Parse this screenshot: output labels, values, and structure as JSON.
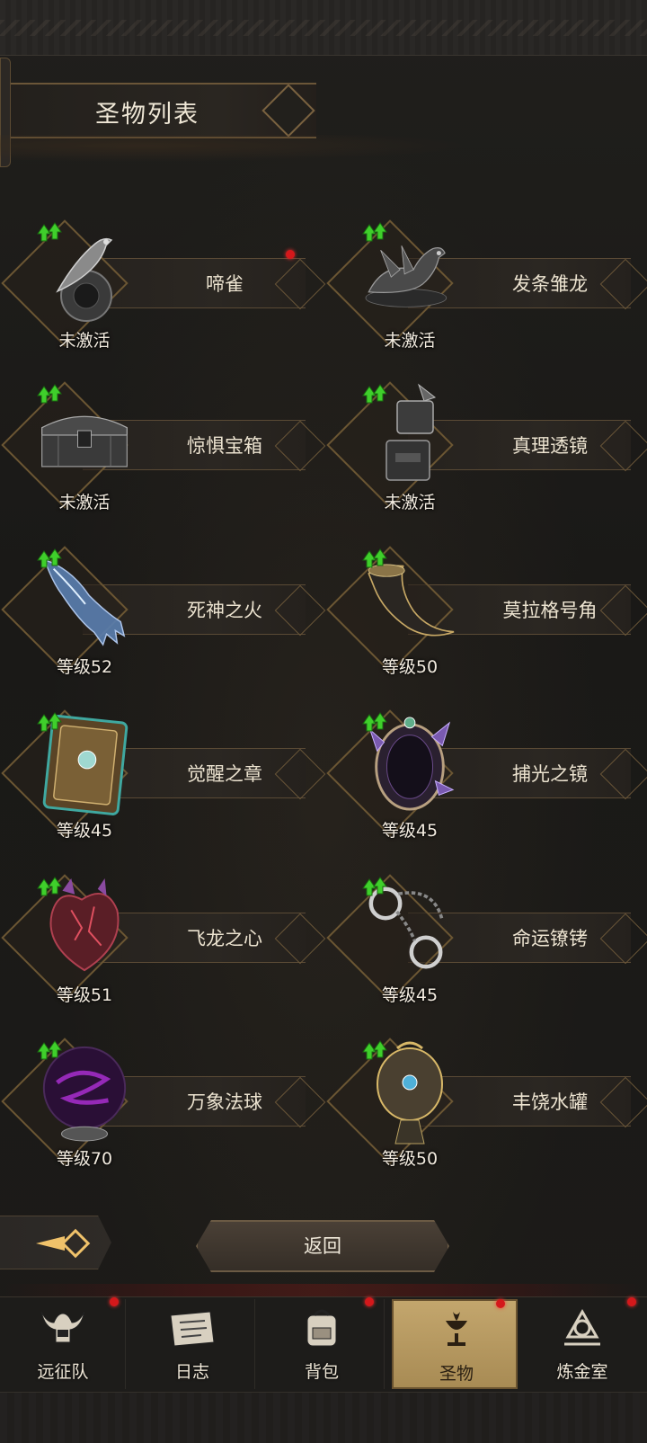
{
  "header": {
    "title": "圣物列表"
  },
  "relics": [
    {
      "name": "啼雀",
      "status": "未激活",
      "has_upgrade": true,
      "has_alert": true,
      "icon": "bird-on-orb-icon"
    },
    {
      "name": "发条雏龙",
      "status": "未激活",
      "has_upgrade": true,
      "has_alert": false,
      "icon": "clockwork-dragon-icon"
    },
    {
      "name": "惊惧宝箱",
      "status": "未激活",
      "has_upgrade": true,
      "has_alert": false,
      "icon": "treasure-chest-icon"
    },
    {
      "name": "真理透镜",
      "status": "未激活",
      "has_upgrade": true,
      "has_alert": false,
      "icon": "lens-tower-icon"
    },
    {
      "name": "死神之火",
      "status": "等级52",
      "has_upgrade": true,
      "has_alert": false,
      "icon": "ghost-hand-icon"
    },
    {
      "name": "莫拉格号角",
      "status": "等级50",
      "has_upgrade": true,
      "has_alert": false,
      "icon": "war-horn-icon"
    },
    {
      "name": "觉醒之章",
      "status": "等级45",
      "has_upgrade": true,
      "has_alert": false,
      "icon": "tome-icon"
    },
    {
      "name": "捕光之镜",
      "status": "等级45",
      "has_upgrade": true,
      "has_alert": false,
      "icon": "crystal-mirror-icon"
    },
    {
      "name": "飞龙之心",
      "status": "等级51",
      "has_upgrade": true,
      "has_alert": false,
      "icon": "dragon-heart-icon"
    },
    {
      "name": "命运镣铐",
      "status": "等级45",
      "has_upgrade": true,
      "has_alert": false,
      "icon": "shackles-icon"
    },
    {
      "name": "万象法球",
      "status": "等级70",
      "has_upgrade": true,
      "has_alert": false,
      "icon": "magic-orb-icon"
    },
    {
      "name": "丰饶水罐",
      "status": "等级50",
      "has_upgrade": true,
      "has_alert": false,
      "icon": "ornate-jar-icon"
    }
  ],
  "footer": {
    "back_label": "返回"
  },
  "nav": [
    {
      "label": "远征队",
      "icon": "horned-helmet-icon",
      "badge": true,
      "active": false
    },
    {
      "label": "日志",
      "icon": "scroll-icon",
      "badge": false,
      "active": false
    },
    {
      "label": "背包",
      "icon": "backpack-icon",
      "badge": true,
      "active": false
    },
    {
      "label": "圣物",
      "icon": "chalice-icon",
      "badge": true,
      "active": true
    },
    {
      "label": "炼金室",
      "icon": "alchemy-icon",
      "badge": true,
      "active": false
    }
  ],
  "colors": {
    "accent_gold": "#b89a5e",
    "alert_red": "#d4181b",
    "upgrade_green": "#3fcf2b"
  }
}
